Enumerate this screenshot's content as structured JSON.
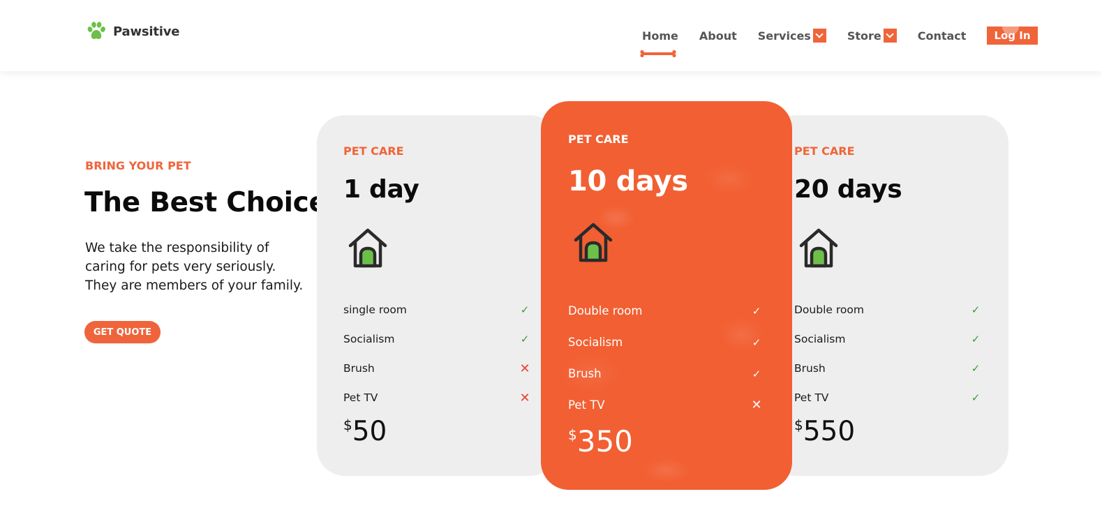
{
  "brand": {
    "name": "Pawsitive",
    "logo_icon": "paw-icon",
    "logo_color": "#6cc04a"
  },
  "nav": {
    "items": [
      {
        "label": "Home",
        "active": true
      },
      {
        "label": "About"
      },
      {
        "label": "Services",
        "has_dropdown": true
      },
      {
        "label": "Store",
        "has_dropdown": true
      },
      {
        "label": "Contact"
      }
    ],
    "login_label": "Log In",
    "active_indicator_icon": "bone-icon"
  },
  "hero": {
    "eyebrow": "BRING YOUR PET",
    "title": "The Best Choice",
    "description": "We take the responsibility of caring for pets very seriously. They are members of your family.",
    "cta_label": "GET QUOTE"
  },
  "colors": {
    "accent": "#f0643a",
    "card_grey": "#eeeeee",
    "check": "#3a9a3a",
    "cross": "#e8432c",
    "house_door": "#6cc04a"
  },
  "plans": [
    {
      "label": "PET CARE",
      "title": "1 day",
      "icon": "dog-house-icon",
      "features": [
        {
          "name": "single room",
          "included": true
        },
        {
          "name": "Socialism",
          "included": true
        },
        {
          "name": "Brush",
          "included": false
        },
        {
          "name": "Pet TV",
          "included": false
        }
      ],
      "currency": "$",
      "price": "50"
    },
    {
      "label": "PET CARE",
      "title": "10 days",
      "icon": "dog-house-icon",
      "featured": true,
      "features": [
        {
          "name": "Double room",
          "included": true
        },
        {
          "name": "Socialism",
          "included": true
        },
        {
          "name": "Brush",
          "included": true
        },
        {
          "name": "Pet TV",
          "included": false
        }
      ],
      "currency": "$",
      "price": "350"
    },
    {
      "label": "PET CARE",
      "title": "20 days",
      "icon": "dog-house-icon",
      "features": [
        {
          "name": "Double room",
          "included": true
        },
        {
          "name": "Socialism",
          "included": true
        },
        {
          "name": "Brush",
          "included": true
        },
        {
          "name": "Pet TV",
          "included": true
        }
      ],
      "currency": "$",
      "price": "550"
    }
  ],
  "marks": {
    "yes": "✓",
    "no": "✕"
  }
}
